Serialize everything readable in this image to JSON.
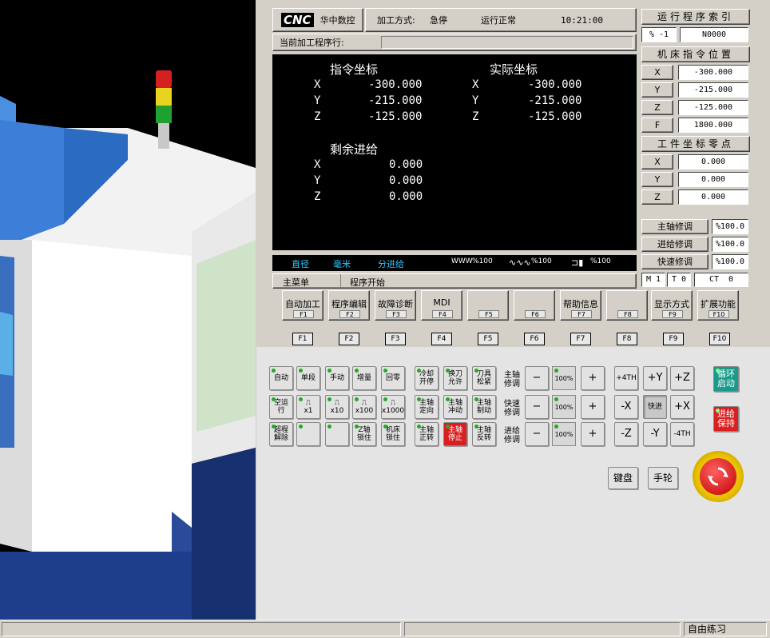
{
  "header": {
    "logo": "CNC",
    "brand": "华中数控",
    "mode_label": "加工方式:",
    "mode_value": "急停",
    "run_status": "运行正常",
    "time": "10:21:00",
    "current_line_label": "当前加工程序行:"
  },
  "screen": {
    "cmd_title": "指令坐标",
    "act_title": "实际坐标",
    "remain_title": "剩余进给",
    "cmd": [
      {
        "axis": "X",
        "value": "-300.000"
      },
      {
        "axis": "Y",
        "value": "-215.000"
      },
      {
        "axis": "Z",
        "value": "-125.000"
      }
    ],
    "act": [
      {
        "axis": "X",
        "value": "-300.000"
      },
      {
        "axis": "Y",
        "value": "-215.000"
      },
      {
        "axis": "Z",
        "value": "-125.000"
      }
    ],
    "remain": [
      {
        "axis": "X",
        "value": "0.000"
      },
      {
        "axis": "Y",
        "value": "0.000"
      },
      {
        "axis": "Z",
        "value": "0.000"
      }
    ]
  },
  "status_bar": {
    "diam": "直径",
    "unit": "毫米",
    "feed": "分进给",
    "spindle_ov": "%100",
    "wave_ov": "%100",
    "rapid_ov": "%100"
  },
  "menu": {
    "main": "主菜单",
    "program": "程序开始"
  },
  "side": {
    "prog_index_title": "运行程序索引",
    "prog_pct": "% -1",
    "prog_n": "N0000",
    "machine_pos_title": "机床指令位置",
    "machine_pos": [
      {
        "axis": "X",
        "value": "-300.000"
      },
      {
        "axis": "Y",
        "value": "-215.000"
      },
      {
        "axis": "Z",
        "value": "-125.000"
      },
      {
        "axis": "F",
        "value": "1800.000"
      }
    ],
    "work_zero_title": "工件坐标零点",
    "work_zero": [
      {
        "axis": "X",
        "value": "0.000"
      },
      {
        "axis": "Y",
        "value": "0.000"
      },
      {
        "axis": "Z",
        "value": "0.000"
      }
    ],
    "overrides": [
      {
        "label": "主轴修调",
        "value": "%100.0"
      },
      {
        "label": "进给修调",
        "value": "%100.0"
      },
      {
        "label": "快速修调",
        "value": "%100.0"
      }
    ],
    "m_label": "M",
    "m_val": "1",
    "t_label": "T",
    "t_val": "0",
    "ct_label": "CT",
    "ct_val": "0"
  },
  "fkeys": [
    {
      "label": "自动加工",
      "key": "F1"
    },
    {
      "label": "程序编辑",
      "key": "F2"
    },
    {
      "label": "故障诊断",
      "key": "F3"
    },
    {
      "label": "MDI",
      "key": "F4"
    },
    {
      "label": "",
      "key": "F5"
    },
    {
      "label": "",
      "key": "F6"
    },
    {
      "label": "帮助信息",
      "key": "F7"
    },
    {
      "label": "",
      "key": "F8"
    },
    {
      "label": "显示方式",
      "key": "F9"
    },
    {
      "label": "扩展功能",
      "key": "F10"
    }
  ],
  "fkey_labels": [
    "F1",
    "F2",
    "F3",
    "F4",
    "F5",
    "F6",
    "F7",
    "F8",
    "F9",
    "F10"
  ],
  "keys": {
    "row1": [
      "自动",
      "单段",
      "手动",
      "增量",
      "回零"
    ],
    "row2": [
      "空运行",
      "x1",
      "x10",
      "x100",
      "x1000"
    ],
    "row3": [
      "超程解除",
      "",
      "",
      "Z轴锁住",
      "机床锁住"
    ],
    "spindle1": [
      "冷却开停",
      "换刀允许",
      "刀具松紧"
    ],
    "spindle2": [
      "主轴定向",
      "主轴冲动",
      "主轴制动"
    ],
    "spindle3": [
      "主轴正转",
      "主轴停止",
      "主轴反转"
    ],
    "ov_labels": [
      "主轴修调",
      "快速修调",
      "进给修调"
    ],
    "ov_value": "100%",
    "minus": "−",
    "plus": "+",
    "jog1": [
      "+4TH",
      "+Y",
      "+Z"
    ],
    "jog2": [
      "-X",
      "快进",
      "+X"
    ],
    "jog3": [
      "-Z",
      "-Y",
      "-4TH"
    ],
    "cycle_start": "循环启动",
    "feed_hold": "进给保持",
    "keyboard": "键盘",
    "handwheel": "手轮"
  },
  "taskbar": {
    "mode": "自由练习"
  }
}
